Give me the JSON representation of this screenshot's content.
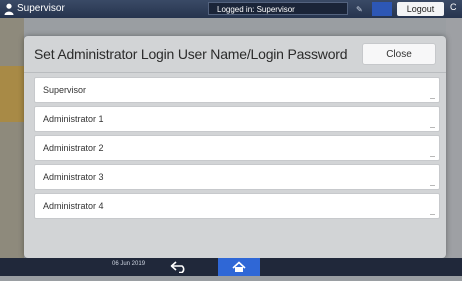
{
  "topbar": {
    "title": "Supervisor",
    "status": "Logged in: Supervisor",
    "logout_label": "Logout",
    "edge_glyph": "C"
  },
  "dialog": {
    "title": "Set Administrator Login User Name/Login Password",
    "close_label": "Close",
    "items": [
      {
        "label": "Supervisor"
      },
      {
        "label": "Administrator 1"
      },
      {
        "label": "Administrator 2"
      },
      {
        "label": "Administrator 3"
      },
      {
        "label": "Administrator 4"
      }
    ]
  },
  "bottombar": {
    "date": "06 Jun 2019"
  },
  "colors": {
    "topbar": "#26344e",
    "accent": "#2f67d6",
    "dialog_bg": "#d2d4d6"
  },
  "icons": [
    "user-icon",
    "back-arrow-icon",
    "home-icon"
  ]
}
